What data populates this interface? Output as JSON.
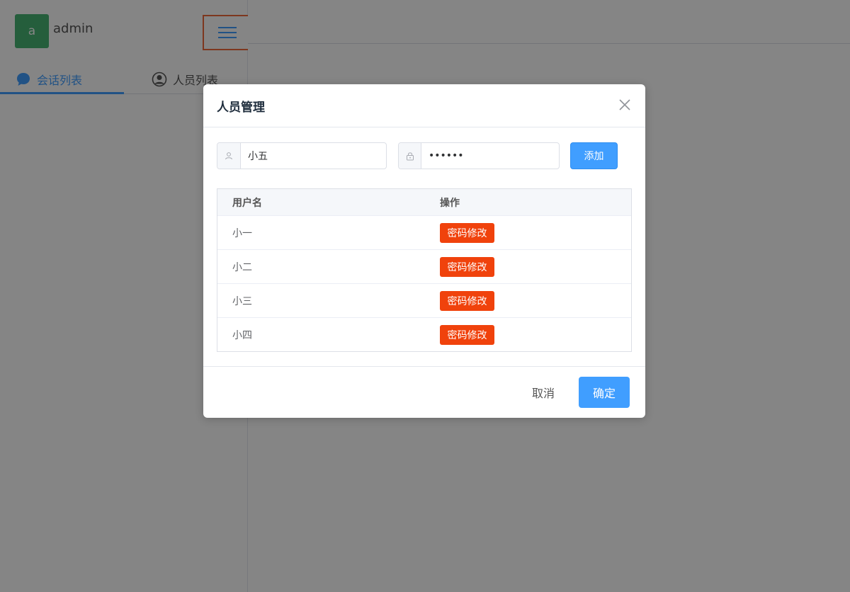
{
  "app": {
    "avatar_letter": "a",
    "username": "admin"
  },
  "sidebar": {
    "tabs": [
      {
        "label": "会话列表",
        "icon": "chat-bubble-icon",
        "active": true
      },
      {
        "label": "人员列表",
        "icon": "user-circle-icon",
        "active": false
      }
    ]
  },
  "dialog": {
    "title": "人员管理",
    "form": {
      "username_value": "小五",
      "password_value": "••••••",
      "add_label": "添加"
    },
    "table": {
      "columns": [
        "用户名",
        "操作"
      ],
      "rows": [
        {
          "name": "小一",
          "action": "密码修改"
        },
        {
          "name": "小二",
          "action": "密码修改"
        },
        {
          "name": "小三",
          "action": "密码修改"
        },
        {
          "name": "小四",
          "action": "密码修改"
        }
      ]
    },
    "footer": {
      "cancel_label": "取消",
      "ok_label": "确定"
    }
  },
  "colors": {
    "primary": "#409eff",
    "danger": "#f0420c",
    "avatar": "#47b574",
    "toggle_outline": "#f06a3b"
  }
}
